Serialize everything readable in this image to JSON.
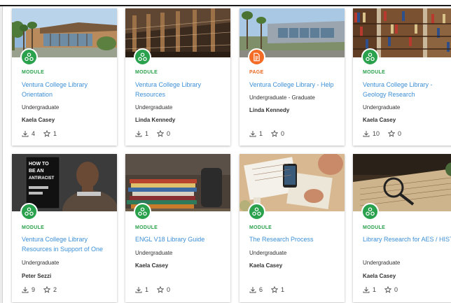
{
  "colors": {
    "module": "#2aa14c",
    "page": "#f36b25",
    "link": "#3c8fd6"
  },
  "cards": [
    {
      "type": "MODULE",
      "title": "Ventura College Library Orientation",
      "level": "Undergraduate",
      "author": "Kaela Casey",
      "downloads": "4",
      "favorites": "1",
      "icon": "module-icon"
    },
    {
      "type": "MODULE",
      "title": "Ventura College Library Resources",
      "level": "Undergraduate",
      "author": "Linda Kennedy",
      "downloads": "1",
      "favorites": "0",
      "icon": "module-icon"
    },
    {
      "type": "PAGE",
      "title": "Ventura College Library - Help",
      "level": "Undergraduate - Graduate",
      "author": "Linda Kennedy",
      "downloads": "1",
      "favorites": "0",
      "icon": "page-icon"
    },
    {
      "type": "MODULE",
      "title": "Ventura College Library - Geology Research",
      "level": "Undergraduate",
      "author": "Kaela Casey",
      "downloads": "10",
      "favorites": "0",
      "icon": "module-icon"
    },
    {
      "type": "MODULE",
      "title": "Ventura College Library Resources in Support of One",
      "level": "Undergraduate",
      "author": "Peter Sezzi",
      "downloads": "9",
      "favorites": "2",
      "icon": "module-icon",
      "cover": {
        "line1": "HOW TO",
        "line2": "BE AN",
        "line3": "ANTIRACIST"
      }
    },
    {
      "type": "MODULE",
      "title": "ENGL V18 Library Guide",
      "level": "Undergraduate",
      "author": "Kaela Casey",
      "downloads": "1",
      "favorites": "0",
      "icon": "module-icon"
    },
    {
      "type": "MODULE",
      "title": "The Research Process",
      "level": "Undergraduate",
      "author": "Kaela Casey",
      "downloads": "6",
      "favorites": "1",
      "icon": "module-icon"
    },
    {
      "type": "MODULE",
      "title": "Library Research for AES / HIST",
      "level": "Undergraduate",
      "author": "Kaela Casey",
      "downloads": "1",
      "favorites": "0",
      "icon": "module-icon"
    }
  ]
}
